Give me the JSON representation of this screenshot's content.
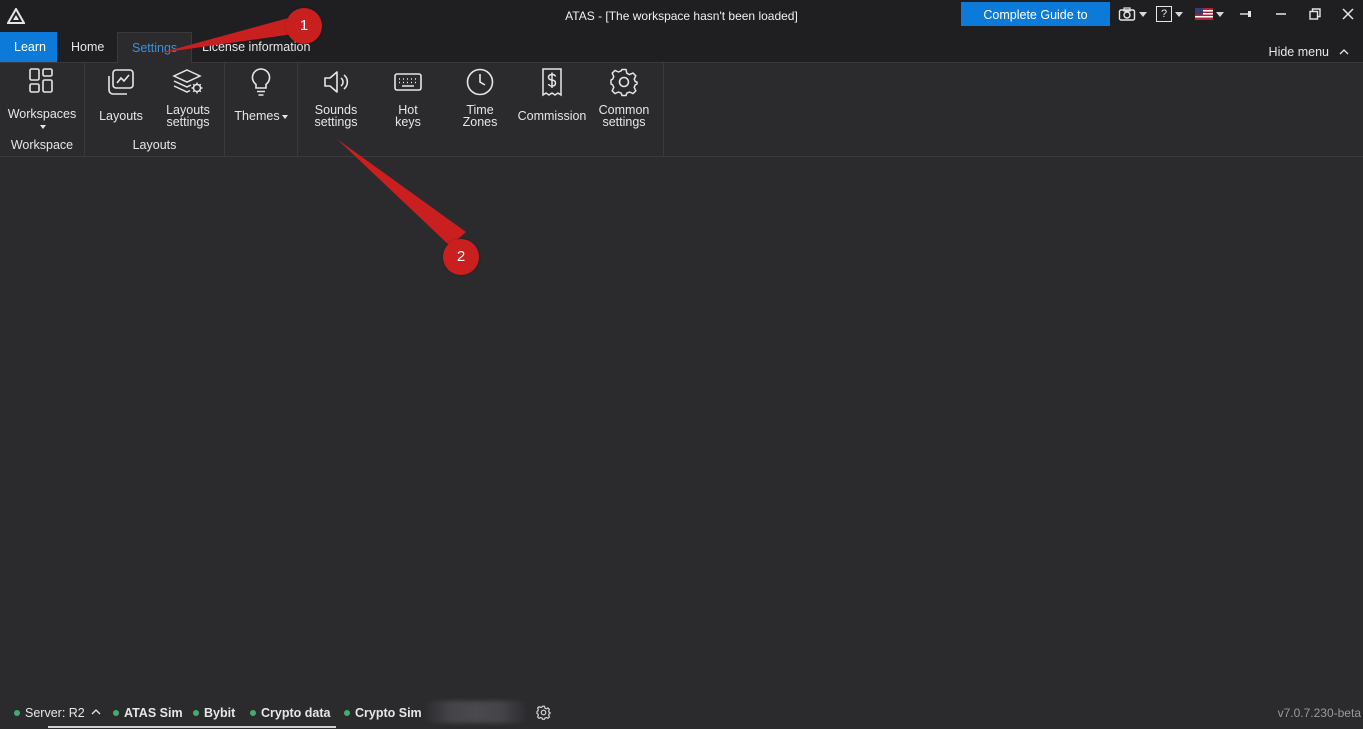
{
  "window": {
    "title": "ATAS - [The workspace hasn't been loaded]",
    "guide_button": "Complete Guide to ATAS",
    "help_label": "?",
    "accent_color": "#0c7ad8"
  },
  "tabs": [
    {
      "label": "Learn"
    },
    {
      "label": "Home"
    },
    {
      "label": "Settings"
    },
    {
      "label": "License information"
    }
  ],
  "hide_menu": "Hide menu",
  "ribbon": {
    "workspace_group": {
      "caption": "Workspace",
      "workspaces": "Workspaces"
    },
    "layouts_group": {
      "caption": "Layouts",
      "layouts": "Layouts",
      "layouts_settings": "Layouts\nsettings"
    },
    "themes_group": {
      "themes": "Themes"
    },
    "settings_group": {
      "sounds_settings": "Sounds\nsettings",
      "hot_keys": "Hot\nkeys",
      "time_zones": "Time\nZones",
      "commission": "Commission",
      "common_settings": "Common\nsettings"
    }
  },
  "annotations": {
    "badge1": "1",
    "badge2": "2",
    "color": "#c91f1f"
  },
  "statusbar": {
    "server": "Server: R2",
    "connections": [
      "ATAS Sim",
      "Bybit",
      "Crypto data",
      "Crypto Sim"
    ],
    "status_color": "#3fae6e",
    "version": "v7.0.7.230-beta"
  }
}
